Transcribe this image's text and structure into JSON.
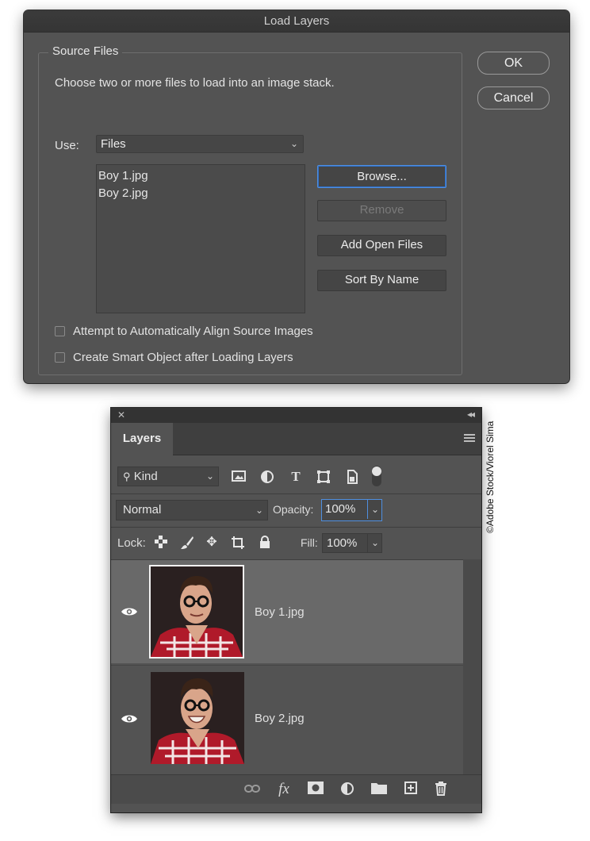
{
  "dialog": {
    "title": "Load Layers",
    "group_label": "Source Files",
    "instruction": "Choose two or more files to load into an image stack.",
    "use_label": "Use:",
    "use_value": "Files",
    "files": [
      "Boy 1.jpg",
      "Boy 2.jpg"
    ],
    "buttons": {
      "browse": "Browse...",
      "remove": "Remove",
      "add_open_files": "Add Open Files",
      "sort_by_name": "Sort By Name",
      "ok": "OK",
      "cancel": "Cancel"
    },
    "checkboxes": {
      "align": "Attempt to Automatically Align Source Images",
      "smart_object": "Create Smart Object after Loading Layers"
    }
  },
  "layers_panel": {
    "tab_label": "Layers",
    "filter_kind": "Kind",
    "blend_mode": "Normal",
    "opacity_label": "Opacity:",
    "opacity_value": "100%",
    "lock_label": "Lock:",
    "fill_label": "Fill:",
    "fill_value": "100%",
    "layers": [
      {
        "name": "Boy 1.jpg",
        "selected": true
      },
      {
        "name": "Boy 2.jpg",
        "selected": false
      }
    ],
    "fx_label": "fx"
  },
  "credit": "©Adobe Stock/Viorel Sima",
  "colors": {
    "panel_bg": "#535353",
    "selected_row": "#696969",
    "focus_blue": "#4f8fe0"
  }
}
